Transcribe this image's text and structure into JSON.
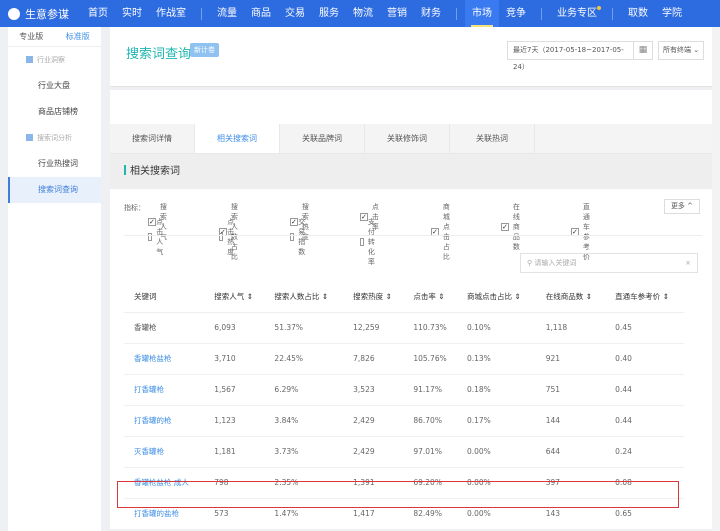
{
  "nav": {
    "brand": "生意参谋",
    "items": [
      "首页",
      "实时",
      "作战室",
      "流量",
      "商品",
      "交易",
      "服务",
      "物流",
      "营销",
      "财务",
      "市场",
      "竞争",
      "业务专区",
      "取数",
      "学院"
    ],
    "active": "市场"
  },
  "sidebar": {
    "versions": [
      "专业版",
      "标准版"
    ],
    "groups": [
      {
        "label": "行业洞察",
        "items": [
          "行业大盘",
          "商品店铺榜"
        ]
      },
      {
        "label": "搜索词分析",
        "items": [
          "行业热搜词",
          "搜索词查询"
        ]
      }
    ],
    "active": "搜索词查询"
  },
  "header": {
    "title": "搜索词查询",
    "tag": "新计卷",
    "date_range": "最近7天（2017-05-18~2017-05-24）",
    "terminal": "所有终端"
  },
  "tabs": [
    "搜索词详情",
    "相关搜索词",
    "关联品牌词",
    "关联修饰词",
    "关联热词"
  ],
  "section_title": "相关搜索词",
  "filters": {
    "label": "指标：",
    "checked": [
      "搜索人气",
      "搜索人数占比",
      "搜索热度",
      "点击率",
      "商城点击占比",
      "在线商品数",
      "直通车参考价"
    ],
    "unchecked": [
      "点击人气",
      "点击热度",
      "交易指数",
      "支付转化率"
    ],
    "more": "更多"
  },
  "search": {
    "placeholder": "请输入关键词"
  },
  "table": {
    "headers": [
      "关键词",
      "搜索人气",
      "搜索人数占比",
      "搜索热度",
      "点击率",
      "商城点击占比",
      "在线商品数",
      "直通车参考价"
    ],
    "rows": [
      [
        "香罐枪",
        "6,093",
        "51.37%",
        "12,259",
        "110.73%",
        "0.10%",
        "1,118",
        "0.45"
      ],
      [
        "香罐枪盐枪",
        "3,710",
        "22.45%",
        "7,826",
        "105.76%",
        "0.13%",
        "921",
        "0.40"
      ],
      [
        "打香罐枪",
        "1,567",
        "6.29%",
        "3,523",
        "91.17%",
        "0.18%",
        "751",
        "0.44"
      ],
      [
        "打香罐的枪",
        "1,123",
        "3.84%",
        "2,429",
        "86.70%",
        "0.17%",
        "144",
        "0.44"
      ],
      [
        "灭香罐枪",
        "1,181",
        "3.73%",
        "2,429",
        "97.01%",
        "0.00%",
        "644",
        "0.24"
      ],
      [
        "香罐枪盐枪 成人",
        "798",
        "2.35%",
        "1,391",
        "69.20%",
        "0.00%",
        "397",
        "0.08"
      ],
      [
        "打香罐的盐枪",
        "573",
        "1.47%",
        "1,417",
        "82.49%",
        "0.00%",
        "143",
        "0.65"
      ]
    ]
  }
}
